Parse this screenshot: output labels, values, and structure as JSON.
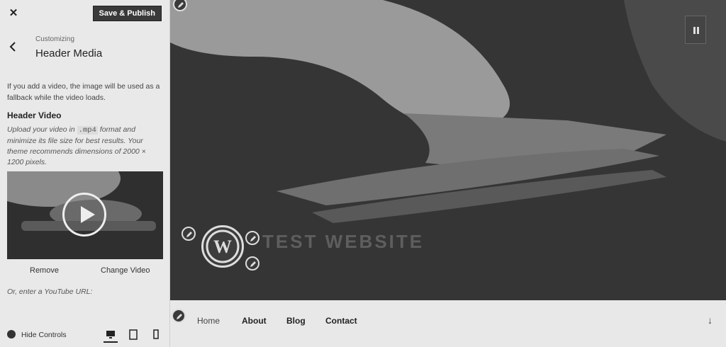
{
  "topbar": {
    "close_symbol": "✕",
    "publish_label": "Save & Publish"
  },
  "section": {
    "customizing_label": "Customizing",
    "title": "Header Media"
  },
  "panel": {
    "note": "If you add a video, the image will be used as a fallback while the video loads.",
    "video_title": "Header Video",
    "desc_before": "Upload your video in ",
    "desc_code": ".mp4",
    "desc_after": " format and minimize its file size for best results. Your theme recommends dimensions of 2000 × 1200 pixels.",
    "remove_label": "Remove",
    "change_label": "Change Video",
    "youtube_label": "Or, enter a YouTube URL:"
  },
  "footer": {
    "hide_controls_label": "Hide Controls"
  },
  "preview": {
    "site_title": "TEST WEBSITE",
    "nav": [
      {
        "label": "Home"
      },
      {
        "label": "About"
      },
      {
        "label": "Blog"
      },
      {
        "label": "Contact"
      }
    ],
    "scroll_symbol": "↓"
  },
  "icons": {
    "close": "close-icon",
    "back": "chevron-left-icon",
    "play": "play-icon",
    "pause": "pause-icon",
    "edit": "pencil-icon",
    "logo": "wordpress-logo-icon",
    "desktop": "desktop-icon",
    "tablet": "tablet-icon",
    "mobile": "mobile-icon",
    "hide_controls": "collapse-icon",
    "scroll": "arrow-down-icon"
  },
  "colors": {
    "publish_bg": "#3a3a3a",
    "sidebar_bg": "#e9e9e9",
    "hero_bg": "#353535"
  }
}
